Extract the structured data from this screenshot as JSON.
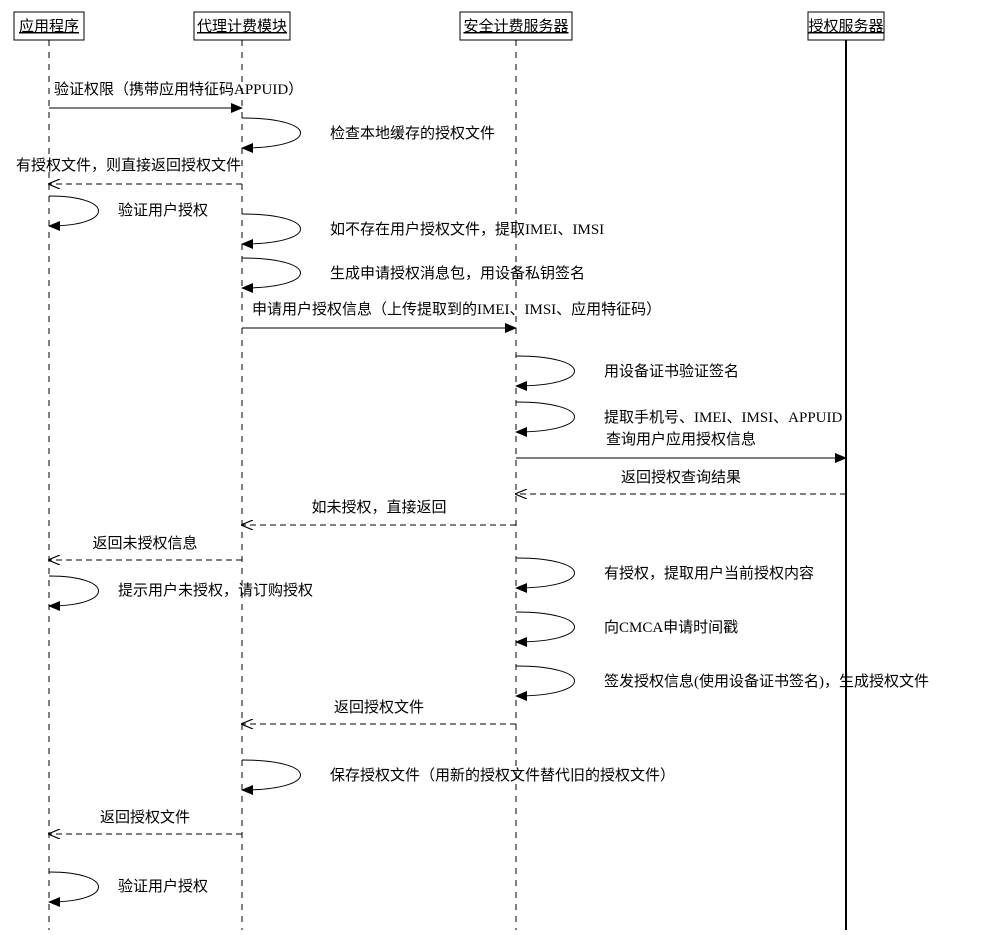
{
  "lifelines": {
    "app": "应用程序",
    "billing": "代理计费模块",
    "secure": "安全计费服务器",
    "auth": "授权服务器"
  },
  "messages": {
    "m1": "验证权限（携带应用特征码APPUID）",
    "m2": "检查本地缓存的授权文件",
    "m3": "有授权文件，则直接返回授权文件",
    "m4": "验证用户授权",
    "m5": "如不存在用户授权文件，提取IMEI、IMSI",
    "m6": "生成申请授权消息包，用设备私钥签名",
    "m7": "申请用户授权信息（上传提取到的IMEI、IMSI、应用特征码）",
    "m8": "用设备证书验证签名",
    "m9": "提取手机号、IMEI、IMSI、APPUID",
    "m10": "查询用户应用授权信息",
    "m11": "返回授权查询结果",
    "m12": "如未授权，直接返回",
    "m13": "返回未授权信息",
    "m14": "提示用户未授权，请订购授权",
    "m15": "有授权，提取用户当前授权内容",
    "m16": "向CMCA申请时间戳",
    "m17": "签发授权信息(使用设备证书签名)，生成授权文件",
    "m18": "返回授权文件",
    "m19": "保存授权文件（用新的授权文件替代旧的授权文件）",
    "m20": "返回授权文件",
    "m21": "验证用户授权"
  }
}
